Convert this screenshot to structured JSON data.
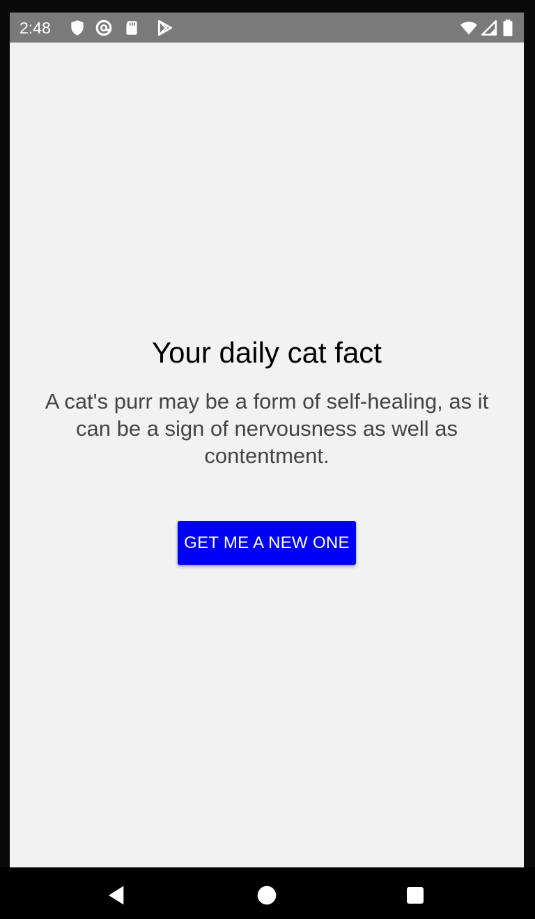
{
  "status_bar": {
    "time": "2:48",
    "left_icons": [
      "shield-icon",
      "at-sign-icon",
      "sd-card-icon",
      "play-store-icon"
    ],
    "right_icons": [
      "wifi-icon",
      "signal-icon",
      "battery-icon"
    ],
    "background_color": "#7a7a7a"
  },
  "main": {
    "title": "Your daily cat fact",
    "fact": "A cat's purr may be a form of self-healing, as it can be a sign of nervousness as well as contentment.",
    "button_label": "GET ME A NEW ONE",
    "button_color": "#0000f5",
    "background_color": "#f2f2f2"
  },
  "nav_bar": {
    "buttons": [
      "back-icon",
      "home-icon",
      "recents-icon"
    ]
  }
}
